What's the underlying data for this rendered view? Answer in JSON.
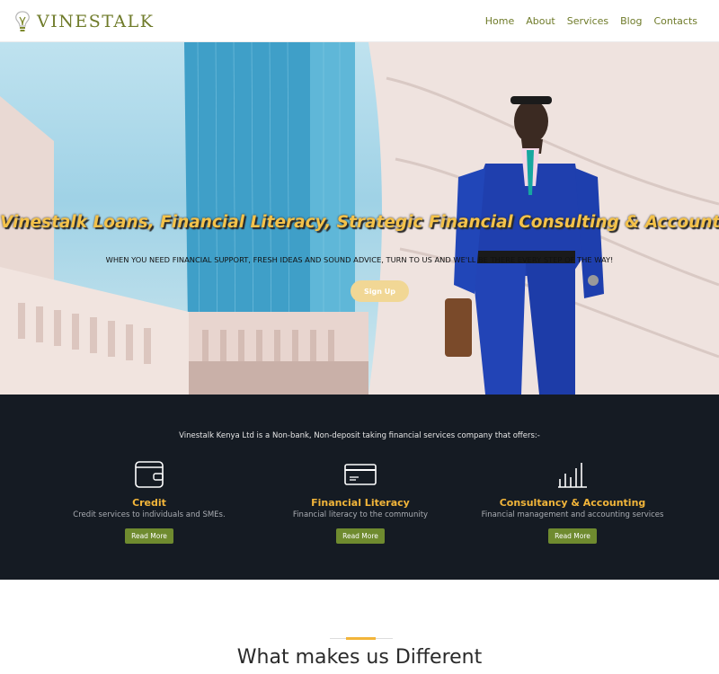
{
  "brand": {
    "name": "VINESTALK",
    "accent": "#6f7b2a"
  },
  "nav": {
    "items": [
      {
        "label": "Home"
      },
      {
        "label": "About"
      },
      {
        "label": "Services"
      },
      {
        "label": "Blog"
      },
      {
        "label": "Contacts"
      }
    ]
  },
  "hero": {
    "title": "Vinestalk Loans, Financial Literacy, Strategic Financial Consulting & Accounting",
    "subtitle": "WHEN YOU NEED FINANCIAL SUPPORT, FRESH IDEAS AND SOUND ADVICE, TURN TO US AND WE'LL BE THERE EVERY STEP OF THE WAY!",
    "cta_label": "Sign Up",
    "title_color": "#f4c24a"
  },
  "services": {
    "intro": "Vinestalk Kenya Ltd is a Non-bank, Non-deposit taking financial services company that offers:-",
    "items": [
      {
        "icon": "wallet-icon",
        "title": "Credit",
        "description": "Credit services to individuals and SMEs.",
        "button": "Read More"
      },
      {
        "icon": "card-icon",
        "title": "Financial Literacy",
        "description": "Financial literacy to the community",
        "button": "Read More"
      },
      {
        "icon": "bar-chart-icon",
        "title": "Consultancy & Accounting",
        "description": "Financial management and accounting services",
        "button": "Read More"
      }
    ],
    "title_color": "#f2b53a",
    "button_color": "#6f8b2f"
  },
  "section": {
    "title": "What makes us Different"
  }
}
